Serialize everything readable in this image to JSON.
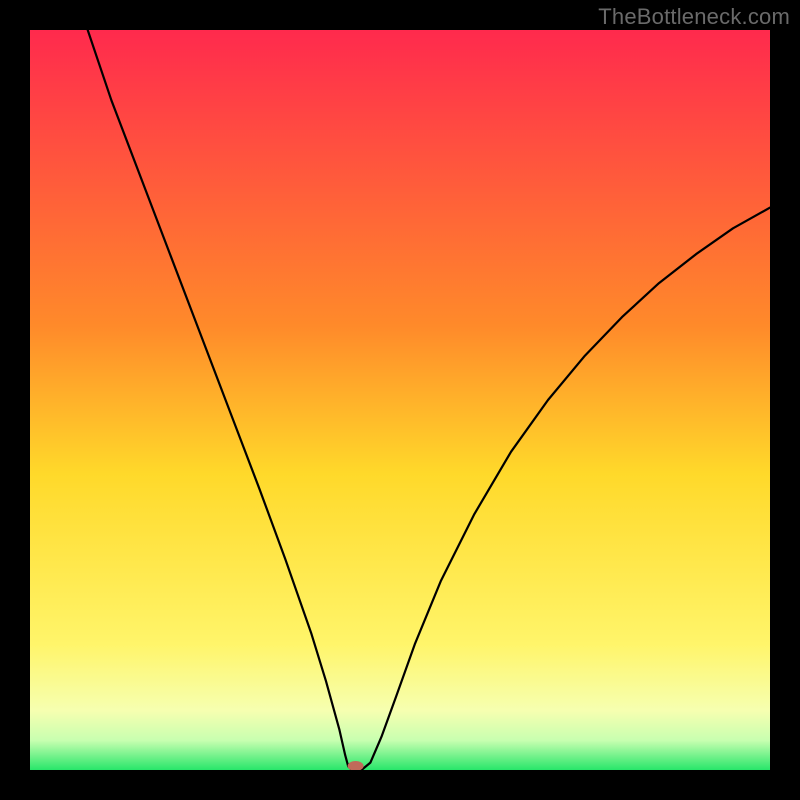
{
  "watermark": "TheBottleneck.com",
  "colors": {
    "frame_background": "#000000",
    "watermark_text": "#6a6a6a",
    "curve": "#000000",
    "marker": "#c06a5a",
    "gradient_stops": [
      {
        "offset": 0.0,
        "color": "#ff2a4d"
      },
      {
        "offset": 0.4,
        "color": "#ff8a2a"
      },
      {
        "offset": 0.6,
        "color": "#ffd92a"
      },
      {
        "offset": 0.83,
        "color": "#fff56a"
      },
      {
        "offset": 0.92,
        "color": "#f6ffb0"
      },
      {
        "offset": 0.96,
        "color": "#c8ffb0"
      },
      {
        "offset": 1.0,
        "color": "#28e66a"
      }
    ]
  },
  "chart_data": {
    "type": "line",
    "title": "",
    "xlabel": "",
    "ylabel": "",
    "xlim": [
      0,
      1
    ],
    "ylim": [
      0,
      1
    ],
    "marker": {
      "x": 0.44,
      "y": 0.0
    },
    "series": [
      {
        "name": "bottleneck-curve",
        "points": [
          {
            "x": 0.078,
            "y": 1.0
          },
          {
            "x": 0.11,
            "y": 0.905
          },
          {
            "x": 0.15,
            "y": 0.8
          },
          {
            "x": 0.19,
            "y": 0.695
          },
          {
            "x": 0.23,
            "y": 0.59
          },
          {
            "x": 0.27,
            "y": 0.485
          },
          {
            "x": 0.31,
            "y": 0.38
          },
          {
            "x": 0.345,
            "y": 0.285
          },
          {
            "x": 0.38,
            "y": 0.185
          },
          {
            "x": 0.4,
            "y": 0.12
          },
          {
            "x": 0.418,
            "y": 0.055
          },
          {
            "x": 0.426,
            "y": 0.02
          },
          {
            "x": 0.43,
            "y": 0.005
          },
          {
            "x": 0.435,
            "y": 0.0
          },
          {
            "x": 0.448,
            "y": 0.0
          },
          {
            "x": 0.46,
            "y": 0.01
          },
          {
            "x": 0.475,
            "y": 0.045
          },
          {
            "x": 0.495,
            "y": 0.1
          },
          {
            "x": 0.52,
            "y": 0.17
          },
          {
            "x": 0.555,
            "y": 0.255
          },
          {
            "x": 0.6,
            "y": 0.345
          },
          {
            "x": 0.65,
            "y": 0.43
          },
          {
            "x": 0.7,
            "y": 0.5
          },
          {
            "x": 0.75,
            "y": 0.56
          },
          {
            "x": 0.8,
            "y": 0.612
          },
          {
            "x": 0.85,
            "y": 0.658
          },
          {
            "x": 0.9,
            "y": 0.697
          },
          {
            "x": 0.95,
            "y": 0.732
          },
          {
            "x": 1.0,
            "y": 0.76
          }
        ]
      }
    ]
  }
}
